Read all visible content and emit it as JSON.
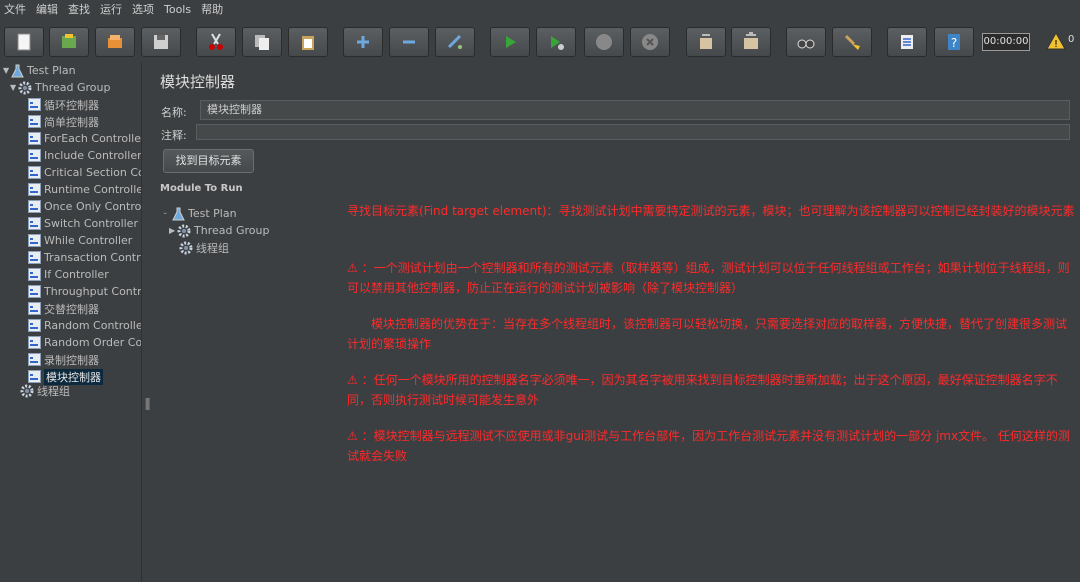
{
  "menu": [
    "文件",
    "编辑",
    "查找",
    "运行",
    "选项",
    "Tools",
    "帮助"
  ],
  "toolbar": {
    "timer": "00:00:00",
    "warning_count": "0",
    "icons": [
      "new-icon",
      "templates-icon",
      "open-icon",
      "save-icon",
      "cut-icon",
      "copy-icon",
      "paste-icon",
      "expand-icon",
      "collapse-icon",
      "toggle-icon",
      "start-icon",
      "start-no-pause-icon",
      "stop-icon",
      "shutdown-icon",
      "clear-icon",
      "clear-all-icon",
      "search-icon",
      "reset-search-icon",
      "function-helper-icon",
      "help-icon"
    ]
  },
  "tree": {
    "root": "Test Plan",
    "group": "Thread Group",
    "items": [
      "循环控制器",
      "简单控制器",
      "ForEach Controller",
      "Include Controller",
      "Critical Section Cor",
      "Runtime Controller",
      "Once Only Controll",
      "Switch Controller",
      "While Controller",
      "Transaction Contro",
      "If Controller",
      "Throughput Contro",
      "交替控制器",
      "Random Controller",
      "Random Order Cor",
      "录制控制器",
      "模块控制器"
    ],
    "selected_index": 16,
    "last_group": "线程组"
  },
  "main": {
    "title": "模块控制器",
    "name_label": "名称:",
    "name_value": "模块控制器",
    "comment_label": "注释:",
    "comment_value": "",
    "find_button": "找到目标元素",
    "module_to_run_label": "Module To Run",
    "mtr_tree": {
      "root": "Test Plan",
      "group": "Thread Group",
      "group2": "线程组"
    }
  },
  "notes": [
    "寻找目标元素(Find target element)：寻找测试计划中需要特定测试的元素，模块；也可理解为该控制器可以控制已经封装好的模块元素",
    "⚠ ：一个测试计划由一个控制器和所有的测试元素（取样器等）组成，测试计划可以位于任何线程组或工作台；如果计划位于线程组，则可以禁用其他控制器，防止正在运行的测试计划被影响（除了模块控制器）",
    "模块控制器的优势在于：当存在多个线程组时，该控制器可以轻松切换，只需要选择对应的取样器，方便快捷，替代了创建很多测试计划的繁琐操作",
    "⚠ ：任何一个模块所用的控制器名字必须唯一，因为其名字被用来找到目标控制器时重新加载；出于这个原因，最好保证控制器名字不同，否则执行测试时候可能发生意外",
    "⚠ ：模块控制器与远程测试不应使用或非gui测试与工作台部件，因为工作台测试元素并没有测试计划的一部分 jmx文件。 任何这样的测试就会失败"
  ]
}
